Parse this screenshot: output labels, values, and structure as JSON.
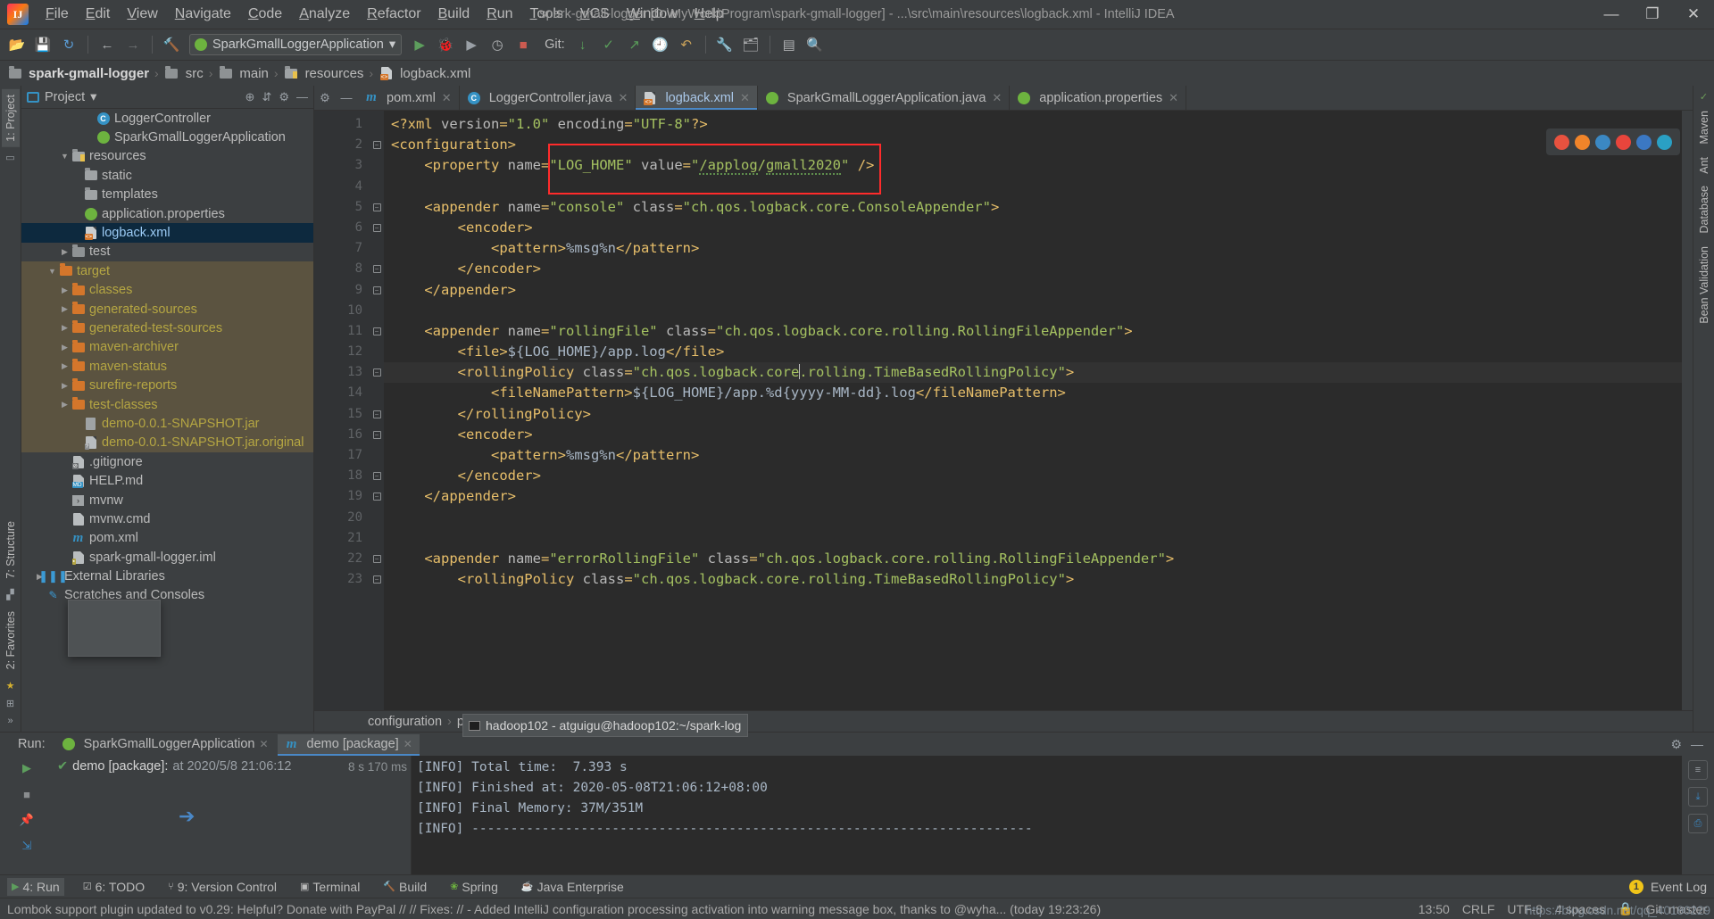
{
  "window": {
    "title": "spark-gmall-logger [D:\\MyWork\\Program\\spark-gmall-logger] - ...\\src\\main\\resources\\logback.xml - IntelliJ IDEA",
    "logo_text": "IJ",
    "minimize": "—",
    "maximize": "❐",
    "close": "✕"
  },
  "menu": [
    {
      "label": "File"
    },
    {
      "label": "Edit"
    },
    {
      "label": "View"
    },
    {
      "label": "Navigate"
    },
    {
      "label": "Code"
    },
    {
      "label": "Analyze"
    },
    {
      "label": "Refactor"
    },
    {
      "label": "Build"
    },
    {
      "label": "Run"
    },
    {
      "label": "Tools"
    },
    {
      "label": "VCS"
    },
    {
      "label": "Window"
    },
    {
      "label": "Help"
    }
  ],
  "toolbar": {
    "open_icon": "📂",
    "save_icon": "💾",
    "sync_icon": "↻",
    "back_icon": "←",
    "forward_icon": "→",
    "build_icon": "🔨",
    "run_config": "SparkGmallLoggerApplication",
    "run_config_caret": "▾",
    "run_icon": "▶",
    "debug_icon": "🐞",
    "coverage_icon": "▶",
    "profile_icon": "◷",
    "stop_icon": "■",
    "git_label": "Git:",
    "git_update_icon": "↓",
    "git_commit_icon": "✓",
    "git_push_icon": "↗",
    "history_icon": "🕘",
    "undo_icon": "↶",
    "settings_icon": "🔧",
    "project_structure_icon": "🗂",
    "layout_icon": "▤",
    "search_icon": "🔍"
  },
  "breadcrumb": [
    {
      "label": "spark-gmall-logger",
      "icon": "module-icon"
    },
    {
      "label": "src",
      "icon": "folder-icon"
    },
    {
      "label": "main",
      "icon": "folder-icon"
    },
    {
      "label": "resources",
      "icon": "resources-folder-icon"
    },
    {
      "label": "logback.xml",
      "icon": "xml-file-icon"
    }
  ],
  "left_rail": {
    "top_tabs": [
      {
        "label": "1: Project",
        "active": true
      }
    ],
    "bottom_tabs": [
      {
        "label": "7: Structure"
      },
      {
        "label": "2: Favorites"
      }
    ]
  },
  "right_rail": {
    "tabs": [
      "Maven",
      "Ant",
      "Database",
      "Bean Validation"
    ]
  },
  "project_panel": {
    "title": "Project",
    "caret": "▾",
    "locate_icon": "⊕",
    "collapse_icon": "⇵",
    "settings_icon": "⚙",
    "hide_icon": "—",
    "tree": [
      {
        "label": "LoggerController",
        "indent": 5,
        "arrow": "",
        "icon": "class-icon",
        "style": ""
      },
      {
        "label": "SparkGmallLoggerApplication",
        "indent": 5,
        "arrow": "",
        "icon": "spring-icon",
        "style": ""
      },
      {
        "label": "resources",
        "indent": 3,
        "arrow": "▼",
        "icon": "resources-icon",
        "style": ""
      },
      {
        "label": "static",
        "indent": 4,
        "arrow": "",
        "icon": "src-folder-icon",
        "style": ""
      },
      {
        "label": "templates",
        "indent": 4,
        "arrow": "",
        "icon": "src-folder-icon",
        "style": ""
      },
      {
        "label": "application.properties",
        "indent": 4,
        "arrow": "",
        "icon": "spring-icon",
        "style": ""
      },
      {
        "label": "logback.xml",
        "indent": 4,
        "arrow": "",
        "icon": "xml-file-icon",
        "style": "sel"
      },
      {
        "label": "test",
        "indent": 3,
        "arrow": "▶",
        "icon": "folder-icon",
        "style": ""
      },
      {
        "label": "target",
        "indent": 2,
        "arrow": "▼",
        "icon": "folder-orange-icon",
        "style": "tgt"
      },
      {
        "label": "classes",
        "indent": 3,
        "arrow": "▶",
        "icon": "folder-orange-icon",
        "style": "tgt"
      },
      {
        "label": "generated-sources",
        "indent": 3,
        "arrow": "▶",
        "icon": "folder-orange-icon",
        "style": "tgt"
      },
      {
        "label": "generated-test-sources",
        "indent": 3,
        "arrow": "▶",
        "icon": "folder-orange-icon",
        "style": "tgt"
      },
      {
        "label": "maven-archiver",
        "indent": 3,
        "arrow": "▶",
        "icon": "folder-orange-icon",
        "style": "tgt"
      },
      {
        "label": "maven-status",
        "indent": 3,
        "arrow": "▶",
        "icon": "folder-orange-icon",
        "style": "tgt"
      },
      {
        "label": "surefire-reports",
        "indent": 3,
        "arrow": "▶",
        "icon": "folder-orange-icon",
        "style": "tgt"
      },
      {
        "label": "test-classes",
        "indent": 3,
        "arrow": "▶",
        "icon": "folder-orange-icon",
        "style": "tgt"
      },
      {
        "label": "demo-0.0.1-SNAPSHOT.jar",
        "indent": 4,
        "arrow": "",
        "icon": "jar-icon",
        "style": "tgt"
      },
      {
        "label": "demo-0.0.1-SNAPSHOT.jar.original",
        "indent": 4,
        "arrow": "",
        "icon": "file-question-icon",
        "style": "tgt"
      },
      {
        "label": ".gitignore",
        "indent": 3,
        "arrow": "",
        "icon": "gitignore-icon",
        "style": ""
      },
      {
        "label": "HELP.md",
        "indent": 3,
        "arrow": "",
        "icon": "markdown-icon",
        "style": ""
      },
      {
        "label": "mvnw",
        "indent": 3,
        "arrow": "",
        "icon": "script-icon",
        "style": ""
      },
      {
        "label": "mvnw.cmd",
        "indent": 3,
        "arrow": "",
        "icon": "cmd-icon",
        "style": ""
      },
      {
        "label": "pom.xml",
        "indent": 3,
        "arrow": "",
        "icon": "maven-icon",
        "style": ""
      },
      {
        "label": "spark-gmall-logger.iml",
        "indent": 3,
        "arrow": "",
        "icon": "iml-icon",
        "style": ""
      },
      {
        "label": "External Libraries",
        "indent": 1,
        "arrow": "▶",
        "icon": "libraries-icon",
        "style": ""
      },
      {
        "label": "Scratches and Consoles",
        "indent": 1,
        "arrow": "",
        "icon": "scratches-icon",
        "style": ""
      }
    ]
  },
  "editor": {
    "tabs": [
      {
        "label": "pom.xml",
        "icon": "maven-icon",
        "active": false
      },
      {
        "label": "LoggerController.java",
        "icon": "class-icon",
        "active": false
      },
      {
        "label": "logback.xml",
        "icon": "xml-file-icon",
        "active": true
      },
      {
        "label": "SparkGmallLoggerApplication.java",
        "icon": "spring-icon",
        "active": false
      },
      {
        "label": "application.properties",
        "icon": "spring-icon",
        "active": false
      }
    ],
    "tab_close": "✕",
    "lines": [
      {
        "n": 1,
        "fold": "",
        "cur": false,
        "html": "<span class='t-pi'>&lt;?xml </span><span class='t-attr'>version</span><span class='t-pi'>=</span><span class='t-val'>\"1.0\"</span><span class='t-attr'> encoding</span><span class='t-pi'>=</span><span class='t-val'>\"UTF-8\"</span><span class='t-pi'>?&gt;</span>"
      },
      {
        "n": 2,
        "fold": "-",
        "cur": false,
        "html": "<span class='t-tag'>&lt;configuration&gt;</span>"
      },
      {
        "n": 3,
        "fold": "",
        "cur": false,
        "html": "    <span class='t-tag'>&lt;property </span><span class='t-attr'>name</span><span class='t-tag'>=</span><span class='t-val'>\"LOG_HOME\"</span><span class='t-attr'> value</span><span class='t-tag'>=</span><span class='t-val'>\"<span class='squig'>/applog</span>/<span class='squig'>gmall2020</span>\"</span> <span class='t-tag'>/&gt;</span>"
      },
      {
        "n": 4,
        "fold": "",
        "cur": false,
        "html": ""
      },
      {
        "n": 5,
        "fold": "-",
        "cur": false,
        "html": "    <span class='t-tag'>&lt;appender </span><span class='t-attr'>name</span><span class='t-tag'>=</span><span class='t-val'>\"console\"</span><span class='t-attr'> class</span><span class='t-tag'>=</span><span class='t-val'>\"ch.qos.logback.core.ConsoleAppender\"</span><span class='t-tag'>&gt;</span>"
      },
      {
        "n": 6,
        "fold": "-",
        "cur": false,
        "html": "        <span class='t-tag'>&lt;encoder&gt;</span>"
      },
      {
        "n": 7,
        "fold": "",
        "cur": false,
        "html": "            <span class='t-tag'>&lt;pattern&gt;</span><span class='t-txt'>%msg%n</span><span class='t-tag'>&lt;/pattern&gt;</span>"
      },
      {
        "n": 8,
        "fold": "-",
        "cur": false,
        "html": "        <span class='t-tag'>&lt;/encoder&gt;</span>"
      },
      {
        "n": 9,
        "fold": "-",
        "cur": false,
        "html": "    <span class='t-tag'>&lt;/appender&gt;</span>"
      },
      {
        "n": 10,
        "fold": "",
        "cur": false,
        "html": ""
      },
      {
        "n": 11,
        "fold": "-",
        "cur": false,
        "html": "    <span class='t-tag'>&lt;appender </span><span class='t-attr'>name</span><span class='t-tag'>=</span><span class='t-val'>\"rollingFile\"</span><span class='t-attr'> class</span><span class='t-tag'>=</span><span class='t-val'>\"ch.qos.logback.core.rolling.RollingFileAppender\"</span><span class='t-tag'>&gt;</span>"
      },
      {
        "n": 12,
        "fold": "",
        "cur": false,
        "html": "        <span class='t-tag'>&lt;file&gt;</span><span class='t-txt'>${LOG_HOME}/app.log</span><span class='t-tag'>&lt;/file&gt;</span>"
      },
      {
        "n": 13,
        "fold": "-",
        "cur": true,
        "html": "        <span class='t-tag'>&lt;rollingPolicy </span><span class='t-attr'>class</span><span class='t-tag'>=</span><span class='t-val'>\"ch.qos.logback.core<span class='caret'></span>.rolling.TimeBasedRollingPolicy\"</span><span class='t-tag'>&gt;</span>"
      },
      {
        "n": 14,
        "fold": "",
        "cur": false,
        "html": "            <span class='t-tag'>&lt;fileNamePattern&gt;</span><span class='t-txt'>${LOG_HOME}/app.%d{yyyy-MM-dd}.log</span><span class='t-tag'>&lt;/fileNamePattern&gt;</span>"
      },
      {
        "n": 15,
        "fold": "-",
        "cur": false,
        "html": "        <span class='t-tag'>&lt;/rollingPolicy&gt;</span>"
      },
      {
        "n": 16,
        "fold": "-",
        "cur": false,
        "html": "        <span class='t-tag'>&lt;encoder&gt;</span>"
      },
      {
        "n": 17,
        "fold": "",
        "cur": false,
        "html": "            <span class='t-tag'>&lt;pattern&gt;</span><span class='t-txt'>%msg%n</span><span class='t-tag'>&lt;/pattern&gt;</span>"
      },
      {
        "n": 18,
        "fold": "-",
        "cur": false,
        "html": "        <span class='t-tag'>&lt;/encoder&gt;</span>"
      },
      {
        "n": 19,
        "fold": "-",
        "cur": false,
        "html": "    <span class='t-tag'>&lt;/appender&gt;</span>"
      },
      {
        "n": 20,
        "fold": "",
        "cur": false,
        "html": ""
      },
      {
        "n": 21,
        "fold": "",
        "cur": false,
        "html": ""
      },
      {
        "n": 22,
        "fold": "-",
        "cur": false,
        "html": "    <span class='t-tag'>&lt;appender </span><span class='t-attr'>name</span><span class='t-tag'>=</span><span class='t-val'>\"errorRollingFile\"</span><span class='t-attr'> class</span><span class='t-tag'>=</span><span class='t-val'>\"ch.qos.logback.core.rolling.RollingFileAppender\"</span><span class='t-tag'>&gt;</span>"
      },
      {
        "n": 23,
        "fold": "-",
        "cur": false,
        "html": "        <span class='t-tag'>&lt;rollingPolicy </span><span class='t-attr'>class</span><span class='t-tag'>=</span><span class='t-val'>\"ch.qos.logback.core.rolling.TimeBasedRollingPolicy\"</span><span class='t-tag'>&gt;</span>"
      }
    ],
    "breadcrumb_bottom": [
      "configuration",
      "property"
    ],
    "breadcrumb_sep": "›"
  },
  "browser_widget": {
    "browsers": [
      "chrome-icon",
      "firefox-icon",
      "ie-icon",
      "opera-icon",
      "edge-legacy-icon",
      "edge-icon"
    ],
    "colors": [
      "#e8523f",
      "#f0842a",
      "#3b88c3",
      "#e8453c",
      "#3b78c3",
      "#2aa0c4"
    ]
  },
  "run_panel": {
    "label": "Run:",
    "tabs": [
      {
        "label": "SparkGmallLoggerApplication",
        "icon": "spring-icon",
        "active": false
      },
      {
        "label": "demo [package]",
        "icon": "maven-icon",
        "active": true
      }
    ],
    "tab_close": "✕",
    "settings_icon": "⚙",
    "hide_icon": "—",
    "side_icons": [
      "rerun-icon",
      "stop-icon",
      "pin-icon",
      "down-icon"
    ],
    "tree_row": {
      "status": "✔",
      "label": "demo [package]:",
      "sub": "at 2020/5/8 21:06:12",
      "duration": "8 s 170 ms"
    },
    "console_lines": [
      "[INFO] Total time:  7.393 s",
      "[INFO] Finished at: 2020-05-08T21:06:12+08:00",
      "[INFO] Final Memory: 37M/351M",
      "[INFO] ------------------------------------------------------------------------"
    ],
    "right_icons": [
      "wrap-icon",
      "scroll-icon",
      "print-icon"
    ]
  },
  "taskbar_item": {
    "label": "hadoop102 - atguigu@hadoop102:~/spark-log",
    "icon": "terminal-icon"
  },
  "toolwindow_bar": {
    "items": [
      {
        "label": "4: Run",
        "key": "4",
        "icon": "run-icon",
        "active": true
      },
      {
        "label": "6: TODO",
        "key": "6",
        "icon": "todo-icon",
        "active": false
      },
      {
        "label": "9: Version Control",
        "key": "9",
        "icon": "vcs-icon",
        "active": false
      },
      {
        "label": "Terminal",
        "key": "",
        "icon": "terminal-icon",
        "active": false
      },
      {
        "label": "Build",
        "key": "",
        "icon": "build-icon",
        "active": false
      },
      {
        "label": "Spring",
        "key": "",
        "icon": "spring-icon",
        "active": false
      },
      {
        "label": "Java Enterprise",
        "key": "",
        "icon": "java-icon",
        "active": false
      }
    ],
    "event_log": "Event Log",
    "event_count": "1"
  },
  "status_bar": {
    "message": "Lombok support plugin updated to v0.29: Helpful? Donate with PayPal // // Fixes: // - Added IntelliJ configuration processing activation into warning message box, thanks to @wyha... (today 19:23:26)",
    "time": "13:50",
    "line_sep": "CRLF",
    "encoding": "UTF-8",
    "indent": "4 spaces",
    "branch": "Git: master",
    "lock_icon": "🔒"
  },
  "watermark": "https://blog.csdn.net/qq_40180229"
}
